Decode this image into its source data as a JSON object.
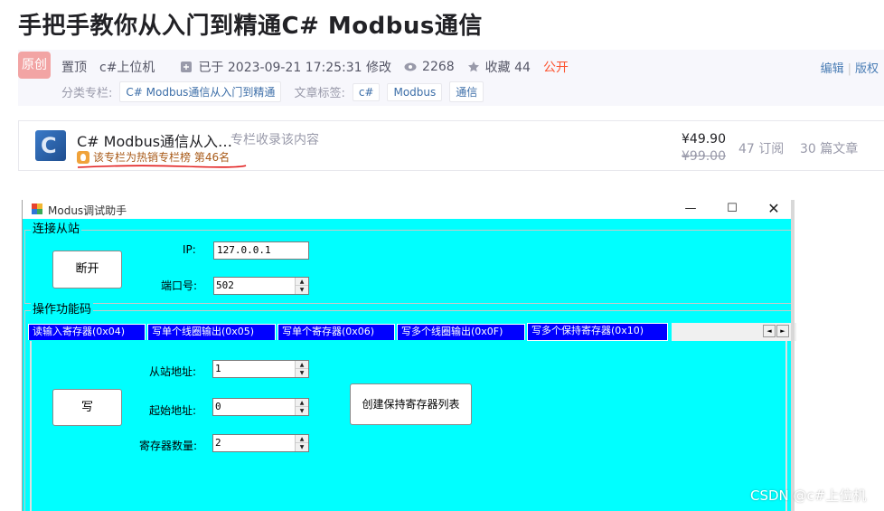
{
  "article": {
    "title": "手把手教你从入门到精通C# Modbus通信",
    "badge": "原创",
    "pinned": "置顶",
    "author": "c#上位机",
    "modified": "已于 2023-09-21 17:25:31 修改",
    "views": "2268",
    "favorites": "收藏 44",
    "visibility": "公开",
    "edit": "编辑",
    "copyright": "版权",
    "category_label": "分类专栏:",
    "category": "C# Modbus通信从入门到精通",
    "tags_label": "文章标签:",
    "tags": [
      "c#",
      "Modbus",
      "通信"
    ]
  },
  "column": {
    "name": "C# Modbus通信从入…",
    "include": "专栏收录该内容",
    "hot": "该专栏为热销专栏榜 第46名",
    "price": "¥49.90",
    "price_old": "¥99.00",
    "subscribers": "47 订阅",
    "article_count": "30 篇文章"
  },
  "app": {
    "title": "Modus调试助手",
    "controls": {
      "minimize": "—",
      "maximize": "☐",
      "close": "✕"
    },
    "connect": {
      "group": "连接从站",
      "button": "断开",
      "ip_label": "IP:",
      "ip_value": "127.0.0.1",
      "port_label": "端口号:",
      "port_value": "502"
    },
    "ops": {
      "group": "操作功能码",
      "tabs": [
        "读输入寄存器(0x04)",
        "写单个线圈输出(0x05)",
        "写单个寄存器(0x06)",
        "写多个线圈输出(0x0F)",
        "写多个保持寄存器(0x10)"
      ],
      "active_tab": 4,
      "scroll_left": "◄",
      "scroll_right": "►",
      "write_button": "写",
      "slave_label": "从站地址:",
      "slave_value": "1",
      "start_label": "起始地址:",
      "start_value": "0",
      "count_label": "寄存器数量:",
      "count_value": "2",
      "create_button": "创建保持寄存器列表"
    }
  },
  "watermark": "CSDN @c#上位机",
  "colors": {
    "form_bg": "#00ffff",
    "tab_bg": "#0000ff",
    "accent_red": "#fc5531",
    "link_blue": "#3c6ea8"
  }
}
